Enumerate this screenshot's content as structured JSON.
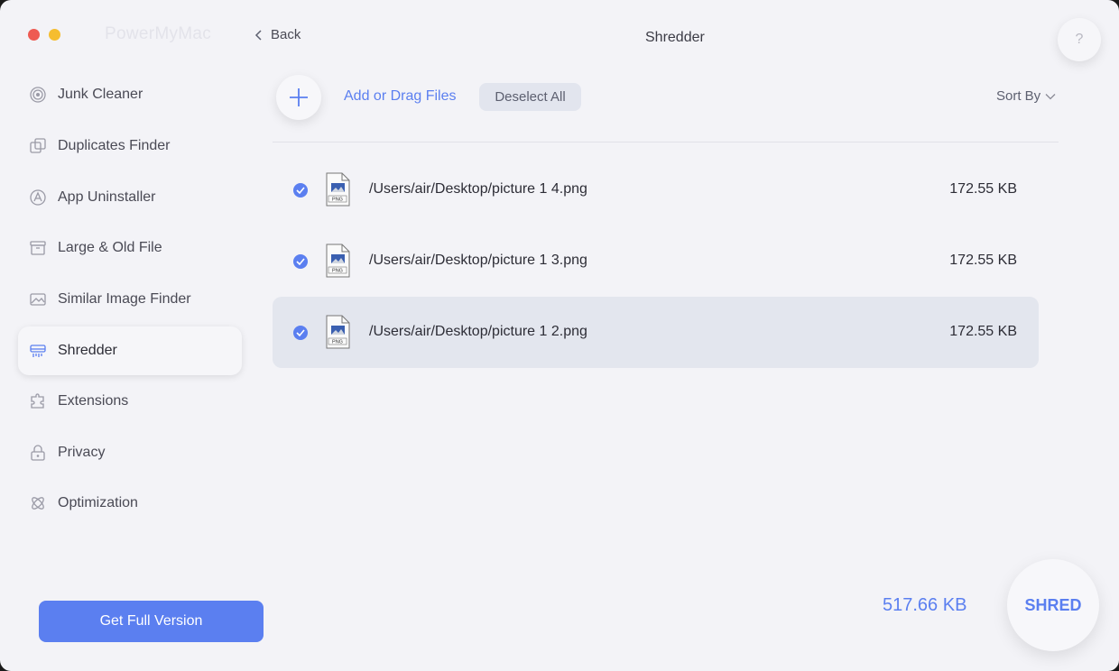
{
  "app": {
    "name": "PowerMyMac",
    "window_title": "Shredder",
    "back_label": "Back",
    "help_label": "?"
  },
  "sidebar": {
    "items": [
      {
        "label": "Junk Cleaner",
        "icon": "junk-cleaner-icon"
      },
      {
        "label": "Duplicates Finder",
        "icon": "duplicates-icon"
      },
      {
        "label": "App Uninstaller",
        "icon": "app-uninstaller-icon"
      },
      {
        "label": "Large & Old File",
        "icon": "large-old-file-icon"
      },
      {
        "label": "Similar Image Finder",
        "icon": "image-icon"
      },
      {
        "label": "Shredder",
        "icon": "shredder-icon",
        "active": true
      },
      {
        "label": "Extensions",
        "icon": "extensions-icon"
      },
      {
        "label": "Privacy",
        "icon": "lock-icon"
      },
      {
        "label": "Optimization",
        "icon": "optimization-icon"
      }
    ],
    "get_full_label": "Get Full Version"
  },
  "toolbar": {
    "add_label": "Add or Drag Files",
    "deselect_label": "Deselect All",
    "sort_label": "Sort By"
  },
  "files": [
    {
      "path": "/Users/air/Desktop/picture 1 4.png",
      "size": "172.55 KB",
      "checked": true,
      "type": "PNG"
    },
    {
      "path": "/Users/air/Desktop/picture 1 3.png",
      "size": "172.55 KB",
      "checked": true,
      "type": "PNG"
    },
    {
      "path": "/Users/air/Desktop/picture 1 2.png",
      "size": "172.55 KB",
      "checked": true,
      "type": "PNG",
      "selected": true
    }
  ],
  "footer": {
    "total_size": "517.66 KB",
    "shred_label": "SHRED"
  },
  "colors": {
    "accent": "#5b7ff0",
    "background": "#f3f3f7",
    "selected_row": "#e3e6ee"
  }
}
